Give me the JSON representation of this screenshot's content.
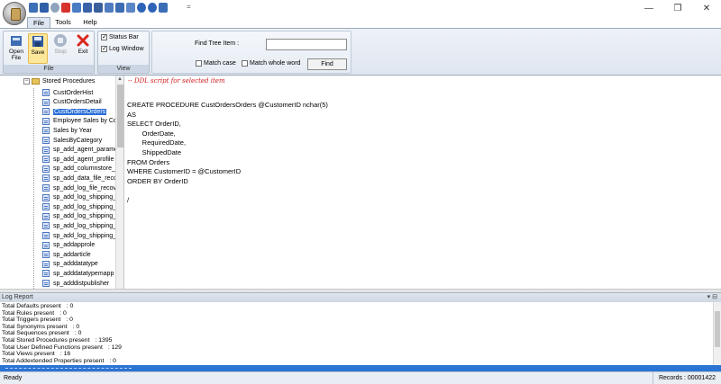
{
  "quick_access": {
    "icons": [
      "open-icon",
      "save-icon",
      "stop-icon",
      "close-icon",
      "folder-icon",
      "save-as-icon",
      "key-icon",
      "find-icon",
      "cart-icon",
      "mail-icon",
      "help-icon",
      "info-icon",
      "register-icon"
    ],
    "separator": "="
  },
  "window": {
    "minimize": "—",
    "restore": "❐",
    "close": "✕"
  },
  "tabs": [
    {
      "label": "File",
      "active": true
    },
    {
      "label": "Tools",
      "active": false
    },
    {
      "label": "Help",
      "active": false
    }
  ],
  "ribbon": {
    "file_group": {
      "label": "File",
      "buttons": [
        {
          "label": "Open\nFile"
        },
        {
          "label": "Save"
        },
        {
          "label": "Stop"
        },
        {
          "label": "Exit"
        }
      ]
    },
    "view_group": {
      "label": "View",
      "status_bar": "Status Bar",
      "log_window": "Log Window",
      "status_bar_checked": true,
      "log_window_checked": true
    },
    "find": {
      "label": "Find Tree Item :",
      "value": "",
      "match_case": "Match case",
      "match_whole_word": "Match whole word",
      "find_button": "Find"
    }
  },
  "tree": {
    "root": "Stored Procedures",
    "items": [
      "CustOrderHist",
      "CustOrdersDetail",
      "CustOrdersOrders",
      "Employee Sales by Co",
      "Sales by Year",
      "SalesByCategory",
      "sp_add_agent_parame",
      "sp_add_agent_profile",
      "sp_add_columnstore_",
      "sp_add_data_file_reco",
      "sp_add_log_file_recov",
      "sp_add_log_shipping_",
      "sp_add_log_shipping_",
      "sp_add_log_shipping_",
      "sp_add_log_shipping_",
      "sp_add_log_shipping_",
      "sp_addapprole",
      "sp_addarticle",
      "sp_adddatatype",
      "sp_adddatatypemapp",
      "sp_adddistpublisher"
    ],
    "selected_index": 2
  },
  "editor": {
    "comment": "-- DDL script for selected item",
    "lines": [
      "CREATE PROCEDURE CustOrdersOrders @CustomerID nchar(5)",
      "AS",
      "SELECT OrderID,",
      "        OrderDate,",
      "        RequiredDate,",
      "        ShippedDate",
      "FROM Orders",
      "WHERE CustomerID = @CustomerID",
      "ORDER BY OrderID",
      "",
      "/"
    ]
  },
  "log": {
    "title": "Log Report",
    "controls": "▾ ⊟",
    "rows": [
      {
        "key": "Total Defaults present",
        "value": ": 0"
      },
      {
        "key": "Total Rules present",
        "value": ": 0"
      },
      {
        "key": "Total Triggers present",
        "value": ": 0"
      },
      {
        "key": "Total Synonyms present",
        "value": ": 0"
      },
      {
        "key": "Total Sequences present",
        "value": ": 0"
      },
      {
        "key": "Total Stored Procedures present",
        "value": ": 1395"
      },
      {
        "key": "Total User Defined Functions present",
        "value": ": 129"
      },
      {
        "key": "Total Views present",
        "value": ": 16"
      },
      {
        "key": "Total Addextended Properties present",
        "value": ": 0"
      }
    ]
  },
  "status": {
    "left": "Ready",
    "right": "Records : 00001422"
  }
}
